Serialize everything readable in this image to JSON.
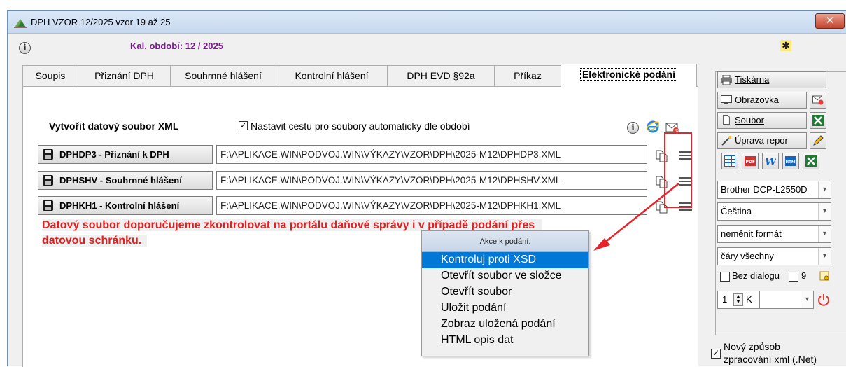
{
  "window": {
    "title": "DPH VZOR 12/2025 vzor 19 až 25",
    "close_label": "✕",
    "period_label": "Kal. období: 12 / 2025"
  },
  "tabs": [
    {
      "label": "Soupis"
    },
    {
      "label": "Přiznání DPH"
    },
    {
      "label": "Souhrnné hlášení"
    },
    {
      "label": "Kontrolní hlášení"
    },
    {
      "label": "DPH EVD §92a"
    },
    {
      "label": "Příkaz"
    },
    {
      "label": "Elektronické podání",
      "active": true
    }
  ],
  "panel": {
    "create_label": "Vytvořit datový soubor XML",
    "auto_path_label": "Nastavit cestu pro soubory automaticky dle období",
    "auto_path_checked": "✓",
    "rows": [
      {
        "button": "DPHDP3 - Přiznání k DPH",
        "path": "F:\\APLIKACE.WIN\\PODVOJ.WIN\\VÝKAZY\\VZOR\\DPH\\2025-M12\\DPHDP3.XML"
      },
      {
        "button": "DPHSHV - Souhrnné hlášení",
        "path": "F:\\APLIKACE.WIN\\PODVOJ.WIN\\VÝKAZY\\VZOR\\DPH\\2025-M12\\DPHSHV.XML"
      },
      {
        "button": "DPHKH1 - Kontrolní hlášení",
        "path": "F:\\APLIKACE.WIN\\PODVOJ.WIN\\VÝKAZY\\VZOR\\DPH\\2025-M12\\DPHKH1.XML"
      }
    ],
    "warning_line1": "Datový soubor doporučujeme zkontrolovat na portálu daňové správy i v případě podání přes",
    "warning_line2": "datovou schránku."
  },
  "context_menu": {
    "header": "Akce k podání:",
    "items": [
      {
        "label": "Kontroluj proti XSD",
        "selected": true
      },
      {
        "label": "Otevřít soubor ve složce"
      },
      {
        "label": "Otevřít soubor"
      },
      {
        "label": "Uložit podání"
      },
      {
        "label": "Zobraz uložená podání"
      },
      {
        "label": "HTML opis dat"
      }
    ]
  },
  "sidebar": {
    "print_label": "Tiskárna",
    "screen_label": "Obrazovka",
    "file_label": "Soubor",
    "report_label": "Úprava repor",
    "printer_value": "Brother DCP-L2550D",
    "language_value": "Čeština",
    "format_value": "neměnit formát",
    "lines_value": "čáry všechny",
    "no_dialog_label": "Bez dialogu",
    "nine_label": "9",
    "copies_value": "1",
    "k_label": "K",
    "new_xml_label_1": "Nový způsob",
    "new_xml_label_2": "zpracování xml (.Net)",
    "new_xml_checked": "✓",
    "format_icons": [
      "table-icon",
      "pdf-icon",
      "word-icon",
      "html-icon",
      "excel-icon"
    ]
  },
  "colors": {
    "warning": "#e02020",
    "period": "#7a1a8c",
    "selection": "#0078d7",
    "highlight_box": "#e8232a"
  }
}
